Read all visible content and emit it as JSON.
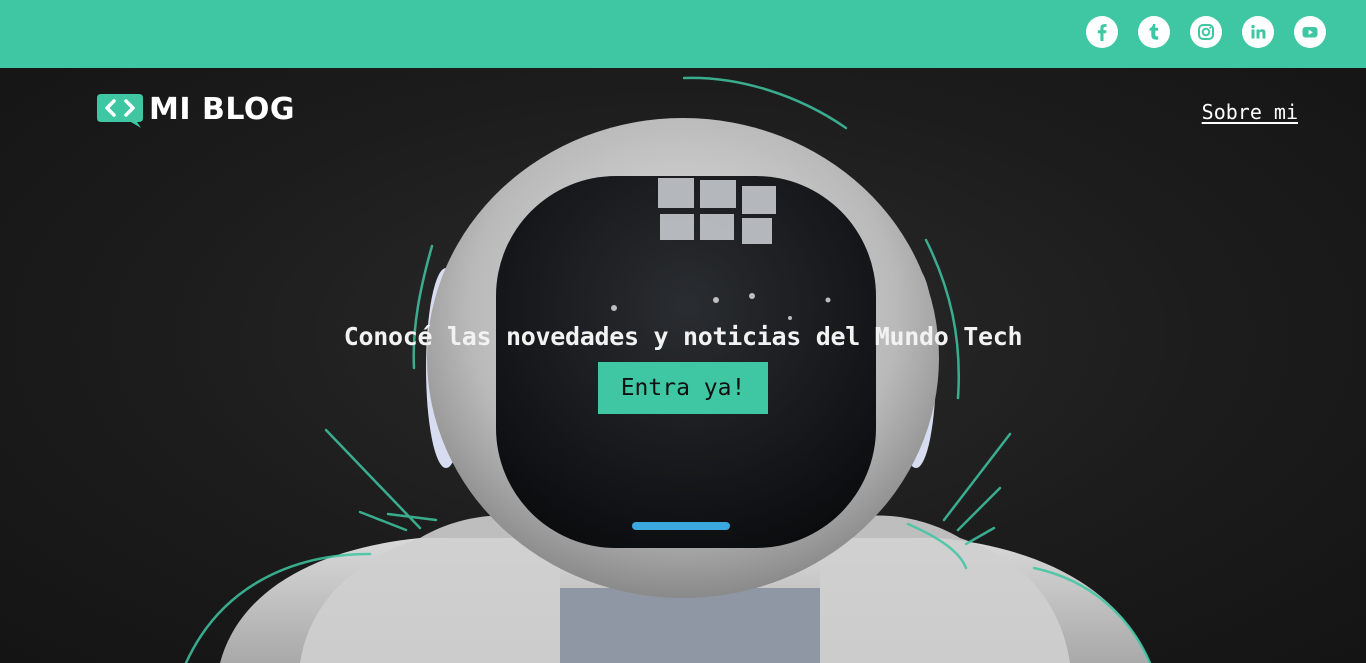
{
  "topbar": {
    "accent": "#3fc6a2",
    "socials": [
      {
        "icon": "facebook-icon"
      },
      {
        "icon": "tumblr-icon"
      },
      {
        "icon": "instagram-icon"
      },
      {
        "icon": "linkedin-icon"
      },
      {
        "icon": "youtube-icon"
      }
    ]
  },
  "header": {
    "logo_icon": "code-bubble-icon",
    "logo_text": "MI BLOG",
    "nav_link": "Sobre mi"
  },
  "hero": {
    "headline": "Conocé las novedades y noticias del Mundo Tech",
    "cta_label": "Entra ya!",
    "background_image": "white robot astronaut helmet on dark background"
  }
}
